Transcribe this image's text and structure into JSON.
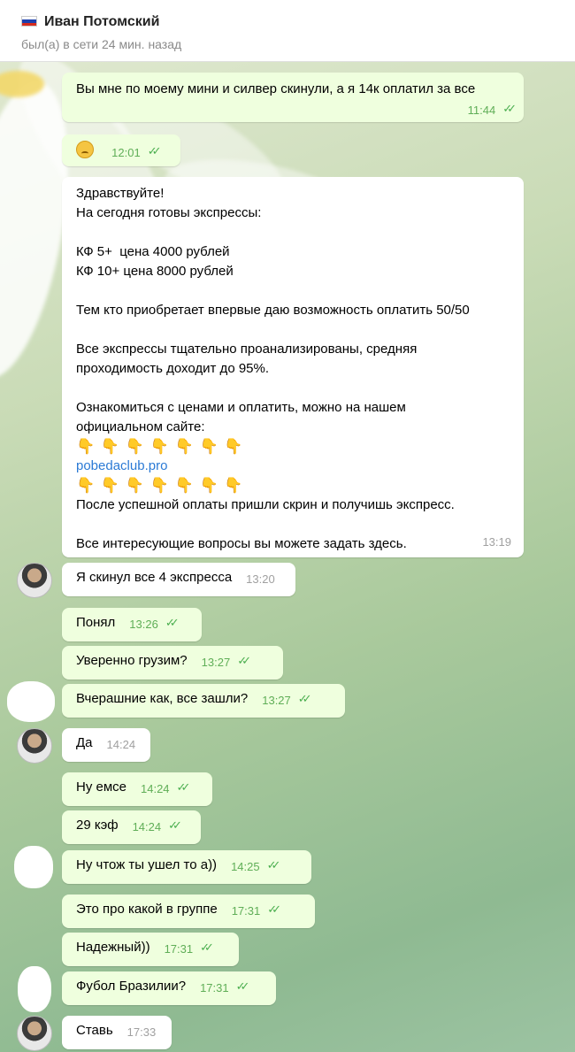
{
  "header": {
    "title": "Иван Потомский",
    "status": "был(а) в сети 24 мин. назад",
    "flag_colors": [
      "#ffffff",
      "#1c3fae",
      "#d52b1e"
    ]
  },
  "messages": [
    {
      "text": "Вы мне по моему мини и силвер скинули, а я 14к оплатил за все",
      "time": "11:44",
      "dir": "out"
    },
    {
      "text": "",
      "emoji": "disappointed-face",
      "time": "12:01",
      "dir": "out"
    },
    {
      "dir": "in",
      "time": "13:19",
      "greeting": "Здравствуйте!\nНа сегодня готовы экспрессы:\n\nКФ 5+  цена 4000 рублей\nКФ 10+ цена 8000 рублей\n\nТем кто приобретает впервые даю возможность оплатить 50/50\n\nВсе экспрессы тщательно проанализированы, средняя\nпроходимость доходит до 95%.\n\nОзнакомиться с ценами и оплатить, можно на нашем\nофициальном сайте:",
      "hands_down": "👇 👇 👇 👇 👇 👇 👇",
      "link": "pobedaclub.pro",
      "hands_down_2": "👇 👇 👇 👇 👇 👇 👇",
      "footer": "После успешной оплаты пришли скрин и получишь экспресс.\n\nВсе интересующие вопросы вы можете задать здесь."
    },
    {
      "text": "Я скинул все 4 экспресса",
      "time": "13:20",
      "dir": "in"
    },
    {
      "text": "Понял",
      "time": "13:26",
      "dir": "out"
    },
    {
      "text": "Уверенно грузим?",
      "time": "13:27",
      "dir": "out"
    },
    {
      "text": "Вчерашние как, все зашли?",
      "time": "13:27",
      "dir": "out"
    },
    {
      "text": "Да",
      "time": "14:24",
      "dir": "in"
    },
    {
      "text": "Ну емсе",
      "time": "14:24",
      "dir": "out"
    },
    {
      "text": "29 кэф",
      "time": "14:24",
      "dir": "out"
    },
    {
      "text": "Ну чтож ты ушел то а))",
      "time": "14:25",
      "dir": "out"
    },
    {
      "text": "Это про какой в группе",
      "time": "17:31",
      "dir": "out"
    },
    {
      "text": "Надежный))",
      "time": "17:31",
      "dir": "out"
    },
    {
      "text": "Фубол Бразилии?",
      "time": "17:31",
      "dir": "out"
    },
    {
      "text": "Ставь",
      "time": "17:33",
      "dir": "in"
    }
  ],
  "colors": {
    "out_bubble": "#efffde",
    "in_bubble": "#ffffff",
    "check": "#4caf50",
    "link": "#2b7ad5"
  }
}
